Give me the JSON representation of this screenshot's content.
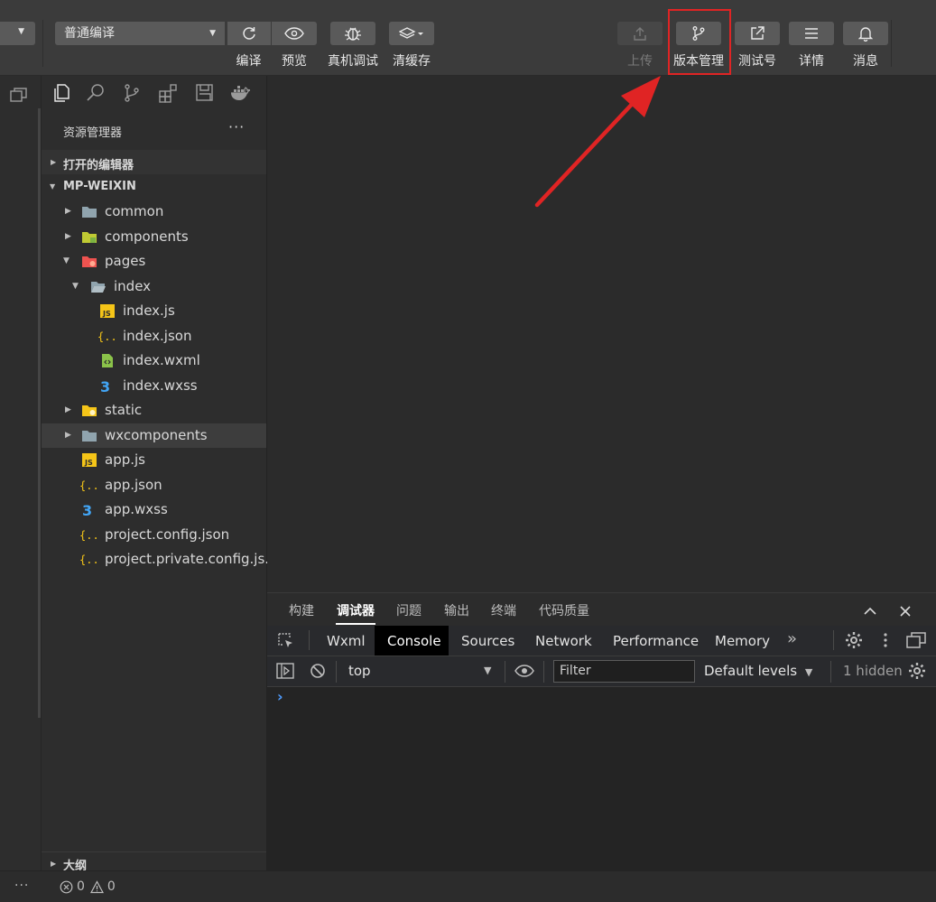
{
  "toolbar": {
    "compile_mode": "普通编译",
    "buttons": [
      {
        "label": "编译",
        "icon": "refresh-icon"
      },
      {
        "label": "预览",
        "icon": "eye-icon"
      },
      {
        "label": "真机调试",
        "icon": "bug-icon"
      },
      {
        "label": "清缓存",
        "icon": "layers-icon"
      },
      {
        "label": "上传",
        "icon": "upload-icon",
        "disabled": true
      },
      {
        "label": "版本管理",
        "icon": "branch-icon"
      },
      {
        "label": "测试号",
        "icon": "external-link-icon"
      },
      {
        "label": "详情",
        "icon": "menu-icon"
      },
      {
        "label": "消息",
        "icon": "bell-icon"
      }
    ]
  },
  "activity_icons": [
    "explorer-icon",
    "search-icon",
    "source-control-icon",
    "extensions-icon",
    "save-icon",
    "docker-icon"
  ],
  "explorer": {
    "title": "资源管理器",
    "more": "···",
    "open_editors": "打开的编辑器",
    "project": "MP-WEIXIN",
    "outline": "大纲",
    "tree": [
      {
        "label": "common",
        "type": "folder"
      },
      {
        "label": "components",
        "type": "folder-components"
      },
      {
        "label": "pages",
        "type": "folder-pages",
        "expanded": true
      },
      {
        "label": "index",
        "type": "folder-open",
        "expanded": true
      },
      {
        "label": "index.js",
        "type": "js"
      },
      {
        "label": "index.json",
        "type": "json"
      },
      {
        "label": "index.wxml",
        "type": "wxml"
      },
      {
        "label": "index.wxss",
        "type": "wxss"
      },
      {
        "label": "static",
        "type": "folder-static"
      },
      {
        "label": "wxcomponents",
        "type": "folder",
        "selected": true
      },
      {
        "label": "app.js",
        "type": "js"
      },
      {
        "label": "app.json",
        "type": "json"
      },
      {
        "label": "app.wxss",
        "type": "wxss"
      },
      {
        "label": "project.config.json",
        "type": "json"
      },
      {
        "label": "project.private.config.js...",
        "type": "json"
      }
    ]
  },
  "debug": {
    "tabs": [
      "构建",
      "调试器",
      "问题",
      "输出",
      "终端",
      "代码质量"
    ],
    "active_tab": "调试器",
    "devtools_tabs": [
      "Wxml",
      "Console",
      "Sources",
      "Network",
      "Performance",
      "Memory"
    ],
    "active_devtools_tab": "Console",
    "more_tabs": "»",
    "context": "top",
    "filter_placeholder": "Filter",
    "levels": "Default levels",
    "hidden": "1 hidden",
    "prompt": "›"
  },
  "status": {
    "more": "···",
    "errors": "0",
    "warnings": "0"
  },
  "colors": {
    "highlight": "#e02424",
    "arrow": "#e02424",
    "js_icon": "#f5c518",
    "wxml_icon": "#8bc34a",
    "wxss_icon": "#42a5f5"
  }
}
